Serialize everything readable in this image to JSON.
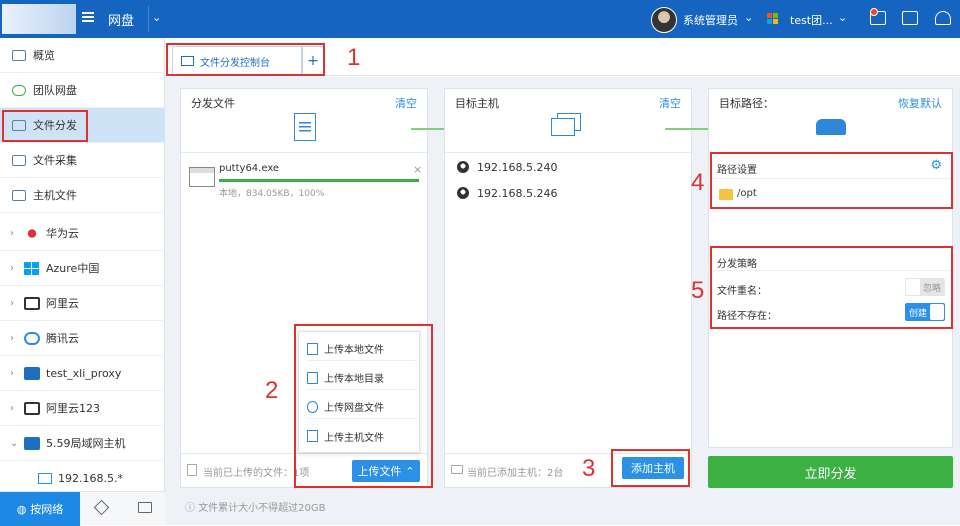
{
  "header": {
    "app_title": "网盘",
    "user_name": "系统管理员",
    "tenant_name": "test团..."
  },
  "sidebar": {
    "items": [
      {
        "label": "概览"
      },
      {
        "label": "团队网盘"
      },
      {
        "label": "文件分发"
      },
      {
        "label": "文件采集"
      },
      {
        "label": "主机文件"
      }
    ],
    "clouds": [
      {
        "label": "华为云"
      },
      {
        "label": "Azure中国"
      },
      {
        "label": "阿里云"
      },
      {
        "label": "腾讯云"
      },
      {
        "label": "test_xli_proxy"
      },
      {
        "label": "阿里云123"
      },
      {
        "label": "5.59局域网主机"
      }
    ],
    "sub_host": "192.168.5.*",
    "bottom_tab_network": "按网络"
  },
  "tabs": {
    "active_label": "文件分发控制台",
    "add_label": "+"
  },
  "source_panel": {
    "title": "分发文件",
    "clear_label": "清空",
    "file": {
      "name": "putty64.exe",
      "meta": "本地，834.05KB，100%",
      "progress_percent": 100
    },
    "footer_text": "当前已上传的文件：1项",
    "upload_button": "上传文件",
    "upload_menu": [
      {
        "label": "上传本地文件"
      },
      {
        "label": "上传本地目录"
      },
      {
        "label": "上传网盘文件"
      },
      {
        "label": "上传主机文件"
      }
    ]
  },
  "target_panel": {
    "title": "目标主机",
    "clear_label": "清空",
    "hosts": [
      "192.168.5.240",
      "192.168.5.246"
    ],
    "footer_text": "当前已添加主机：2台",
    "add_host_button": "添加主机"
  },
  "path_panel": {
    "title": "目标路径：",
    "reset_label": "恢复默认",
    "path_settings_title": "路径设置",
    "path": "/opt",
    "strategy_title": "分发策略",
    "rename_label": "文件重名：",
    "rename_value": "忽略",
    "missing_label": "路径不存在：",
    "missing_value": "创建",
    "distribute_button": "立即分发"
  },
  "limit_text": "文件累计大小不得超过20GB",
  "annotations": [
    "1",
    "2",
    "3",
    "4",
    "5"
  ],
  "colors": {
    "header": "#1565c0",
    "accent": "#2b90e6",
    "success": "#3cb043",
    "annotation": "#e03131"
  }
}
